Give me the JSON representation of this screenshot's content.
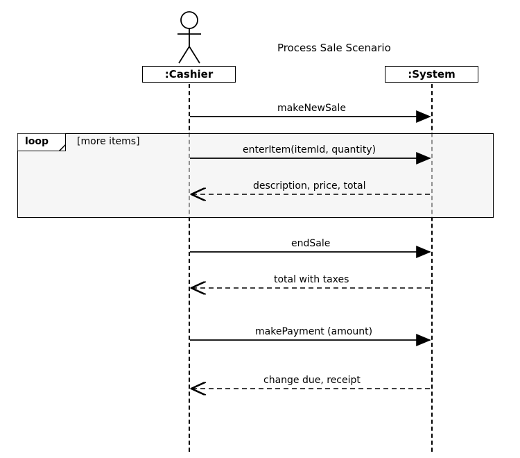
{
  "title": "Process Sale Scenario",
  "participants": {
    "cashier": ":Cashier",
    "system": ":System"
  },
  "fragment": {
    "operator": "loop",
    "guard": "[more items]"
  },
  "messages": {
    "m1": "makeNewSale",
    "m2": "enterItem(itemId, quantity)",
    "m3": "description, price, total",
    "m4": "endSale",
    "m5": "total with taxes",
    "m6": "makePayment (amount)",
    "m7": "change due, receipt"
  },
  "chart_data": {
    "type": "sequence_diagram",
    "title": "Process Sale Scenario",
    "actors": [
      {
        "name": ":Cashier",
        "kind": "actor"
      },
      {
        "name": ":System",
        "kind": "object"
      }
    ],
    "interactions": [
      {
        "from": ":Cashier",
        "to": ":System",
        "label": "makeNewSale",
        "style": "sync"
      },
      {
        "fragment": "loop",
        "guard": "[more items]",
        "interactions": [
          {
            "from": ":Cashier",
            "to": ":System",
            "label": "enterItem(itemId, quantity)",
            "style": "sync"
          },
          {
            "from": ":System",
            "to": ":Cashier",
            "label": "description, price, total",
            "style": "return"
          }
        ]
      },
      {
        "from": ":Cashier",
        "to": ":System",
        "label": "endSale",
        "style": "sync"
      },
      {
        "from": ":System",
        "to": ":Cashier",
        "label": "total with taxes",
        "style": "return"
      },
      {
        "from": ":Cashier",
        "to": ":System",
        "label": "makePayment (amount)",
        "style": "sync"
      },
      {
        "from": ":System",
        "to": ":Cashier",
        "label": "change due, receipt",
        "style": "return"
      }
    ]
  }
}
